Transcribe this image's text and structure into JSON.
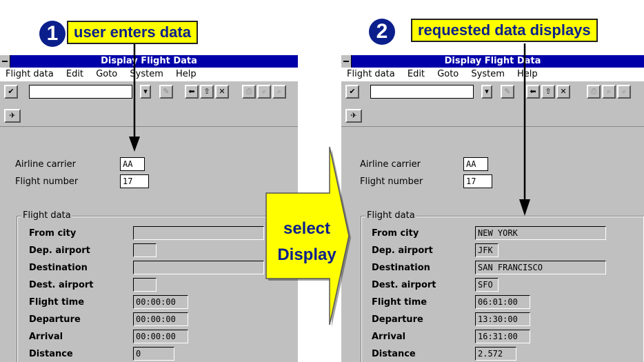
{
  "steps": [
    {
      "number": "1",
      "label": "user enters data"
    },
    {
      "number": "2",
      "label": "requested data displays"
    }
  ],
  "action": {
    "line1": "select",
    "line2": "Display"
  },
  "window": {
    "title": "Display Flight Data",
    "menu": [
      "Flight data",
      "Edit",
      "Goto",
      "System",
      "Help"
    ],
    "labels": {
      "airline": "Airline carrier",
      "flight_number": "Flight number",
      "group": "Flight data"
    },
    "field_labels": [
      "From city",
      "Dep. airport",
      "Destination",
      "Dest. airport",
      "Flight time",
      "Departure",
      "Arrival",
      "Distance"
    ]
  },
  "before": {
    "airline": "AA",
    "flight_number": "17",
    "fields": [
      "",
      "",
      "",
      "",
      "00:00:00",
      "00:00:00",
      "00:00:00",
      "0"
    ]
  },
  "after": {
    "airline": "AA",
    "flight_number": "17",
    "fields": [
      "NEW YORK",
      "JFK",
      "SAN FRANCISCO",
      "SFO",
      "06:01:00",
      "13:30:00",
      "16:31:00",
      "2.572"
    ]
  },
  "colors": {
    "title_bar": "#0000a8",
    "callout_bg": "#ffff00",
    "callout_text": "#0b1f8c",
    "window_bg": "#c0c0c0"
  }
}
